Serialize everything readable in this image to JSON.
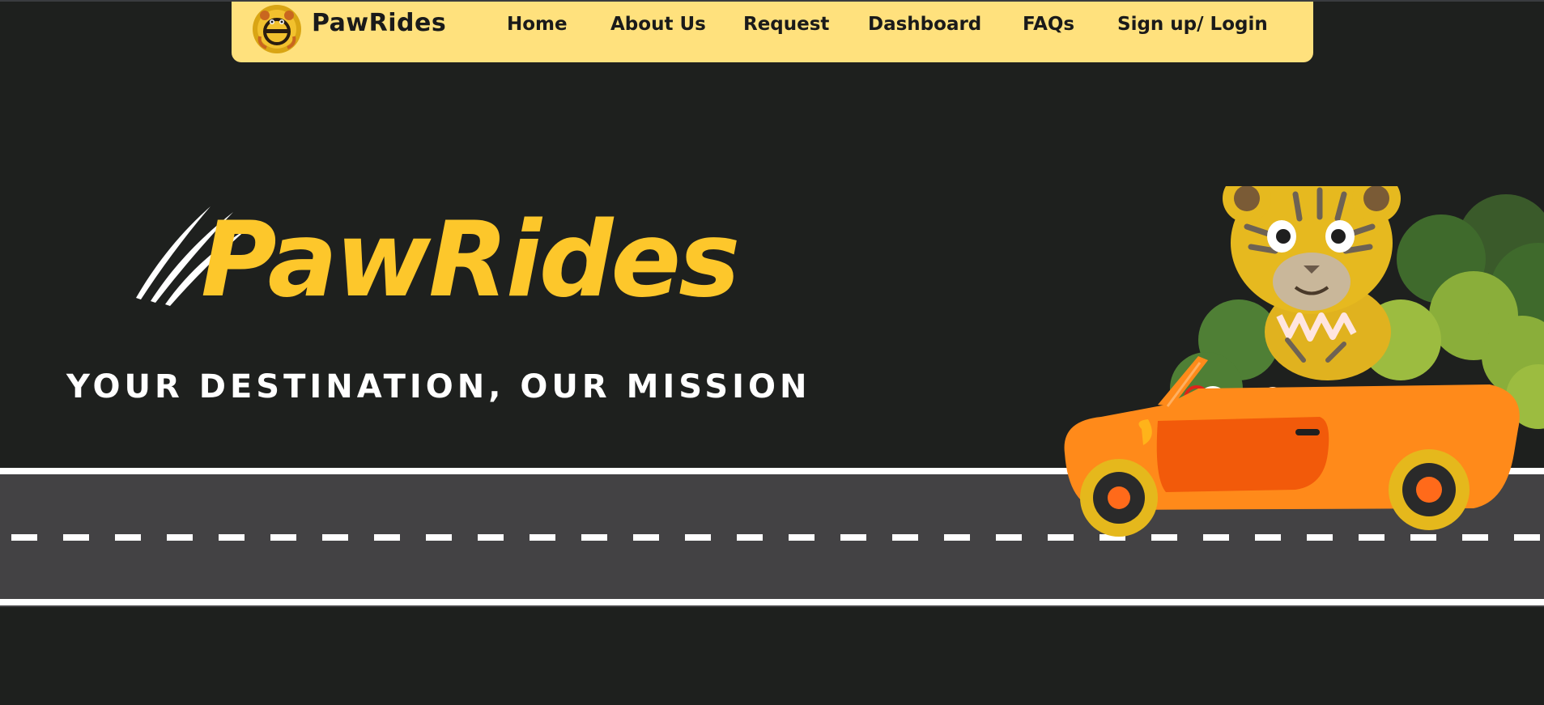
{
  "navbar": {
    "brand": "PawRides",
    "links": [
      {
        "label": "Home"
      },
      {
        "label": "About Us"
      },
      {
        "label": "Request"
      },
      {
        "label": "Dashboard"
      },
      {
        "label": "FAQs"
      },
      {
        "label": "Sign up/ Login"
      }
    ]
  },
  "hero": {
    "title": "PawRides",
    "tagline": "YOUR DESTINATION, OUR MISSION"
  },
  "colors": {
    "background": "#1e201e",
    "navbar": "#ffe17d",
    "brand_yellow": "#fdc72b",
    "road": "#434244",
    "car_orange": "#ff8a1a"
  },
  "icons": {
    "nav_logo": "tiger-steering-wheel-logo",
    "claws": "claw-marks-icon",
    "illustration": "tiger-driving-car-illustration"
  }
}
